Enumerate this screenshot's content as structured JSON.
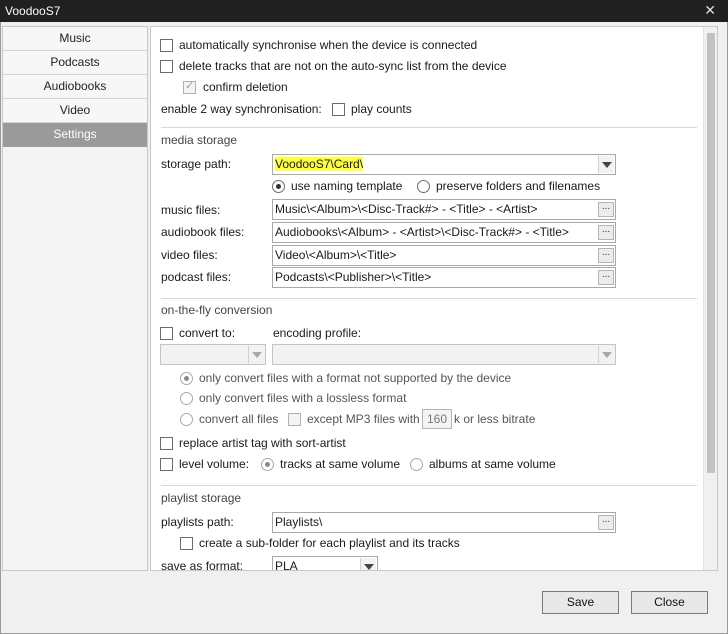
{
  "window": {
    "title": "VoodooS7"
  },
  "sidebar": {
    "items": [
      {
        "label": "Music"
      },
      {
        "label": "Podcasts"
      },
      {
        "label": "Audiobooks"
      },
      {
        "label": "Video"
      },
      {
        "label": "Settings",
        "active": true
      }
    ]
  },
  "sync": {
    "auto_sync_label": "automatically synchronise when the device is connected",
    "auto_sync_checked": false,
    "delete_tracks_label": "delete tracks that are not on the auto-sync list from the device",
    "delete_tracks_checked": false,
    "confirm_deletion_label": "confirm deletion",
    "confirm_deletion_checked": true,
    "two_way_label": "enable 2 way synchronisation:",
    "play_counts_label": "play counts",
    "play_counts_checked": false
  },
  "media_storage": {
    "heading": "media storage",
    "storage_path_label": "storage path:",
    "storage_path_value": "VoodooS7\\Card\\",
    "naming_template_label": "use naming template",
    "naming_template_selected": true,
    "preserve_folders_label": "preserve folders and filenames",
    "music_files_label": "music files:",
    "music_files_value": "Music\\<Album>\\<Disc-Track#> - <Title> - <Artist>",
    "audiobook_files_label": "audiobook files:",
    "audiobook_files_value": "Audiobooks\\<Album> - <Artist>\\<Disc-Track#> - <Title>",
    "video_files_label": "video files:",
    "video_files_value": "Video\\<Album>\\<Title>",
    "podcast_files_label": "podcast files:",
    "podcast_files_value": "Podcasts\\<Publisher>\\<Title>",
    "browse_label": "..."
  },
  "conversion": {
    "heading": "on-the-fly conversion",
    "convert_to_label": "convert to:",
    "convert_to_checked": false,
    "encoding_profile_label": "encoding profile:",
    "opt_unsupported_label": "only convert files with a format not supported by the device",
    "opt_lossless_label": "only convert files with a lossless format",
    "opt_all_label": "convert all files",
    "except_mp3_label": "except MP3 files with",
    "bitrate_value": "160",
    "bitrate_suffix": "k or less bitrate",
    "replace_artist_label": "replace artist tag with sort-artist",
    "level_volume_label": "level volume:",
    "tracks_same_volume_label": "tracks at same volume",
    "albums_same_volume_label": "albums at same volume"
  },
  "playlist_storage": {
    "heading": "playlist storage",
    "playlists_path_label": "playlists path:",
    "playlists_path_value": "Playlists\\",
    "subfolder_label": "create a sub-folder for each playlist and its tracks",
    "save_format_label": "save as format:",
    "save_format_value": "PLA"
  },
  "footer": {
    "save_label": "Save",
    "close_label": "Close"
  },
  "colors": {
    "highlight": "#ffff3c",
    "active_tab": "#9a9a9a",
    "titlebar": "#202020"
  }
}
